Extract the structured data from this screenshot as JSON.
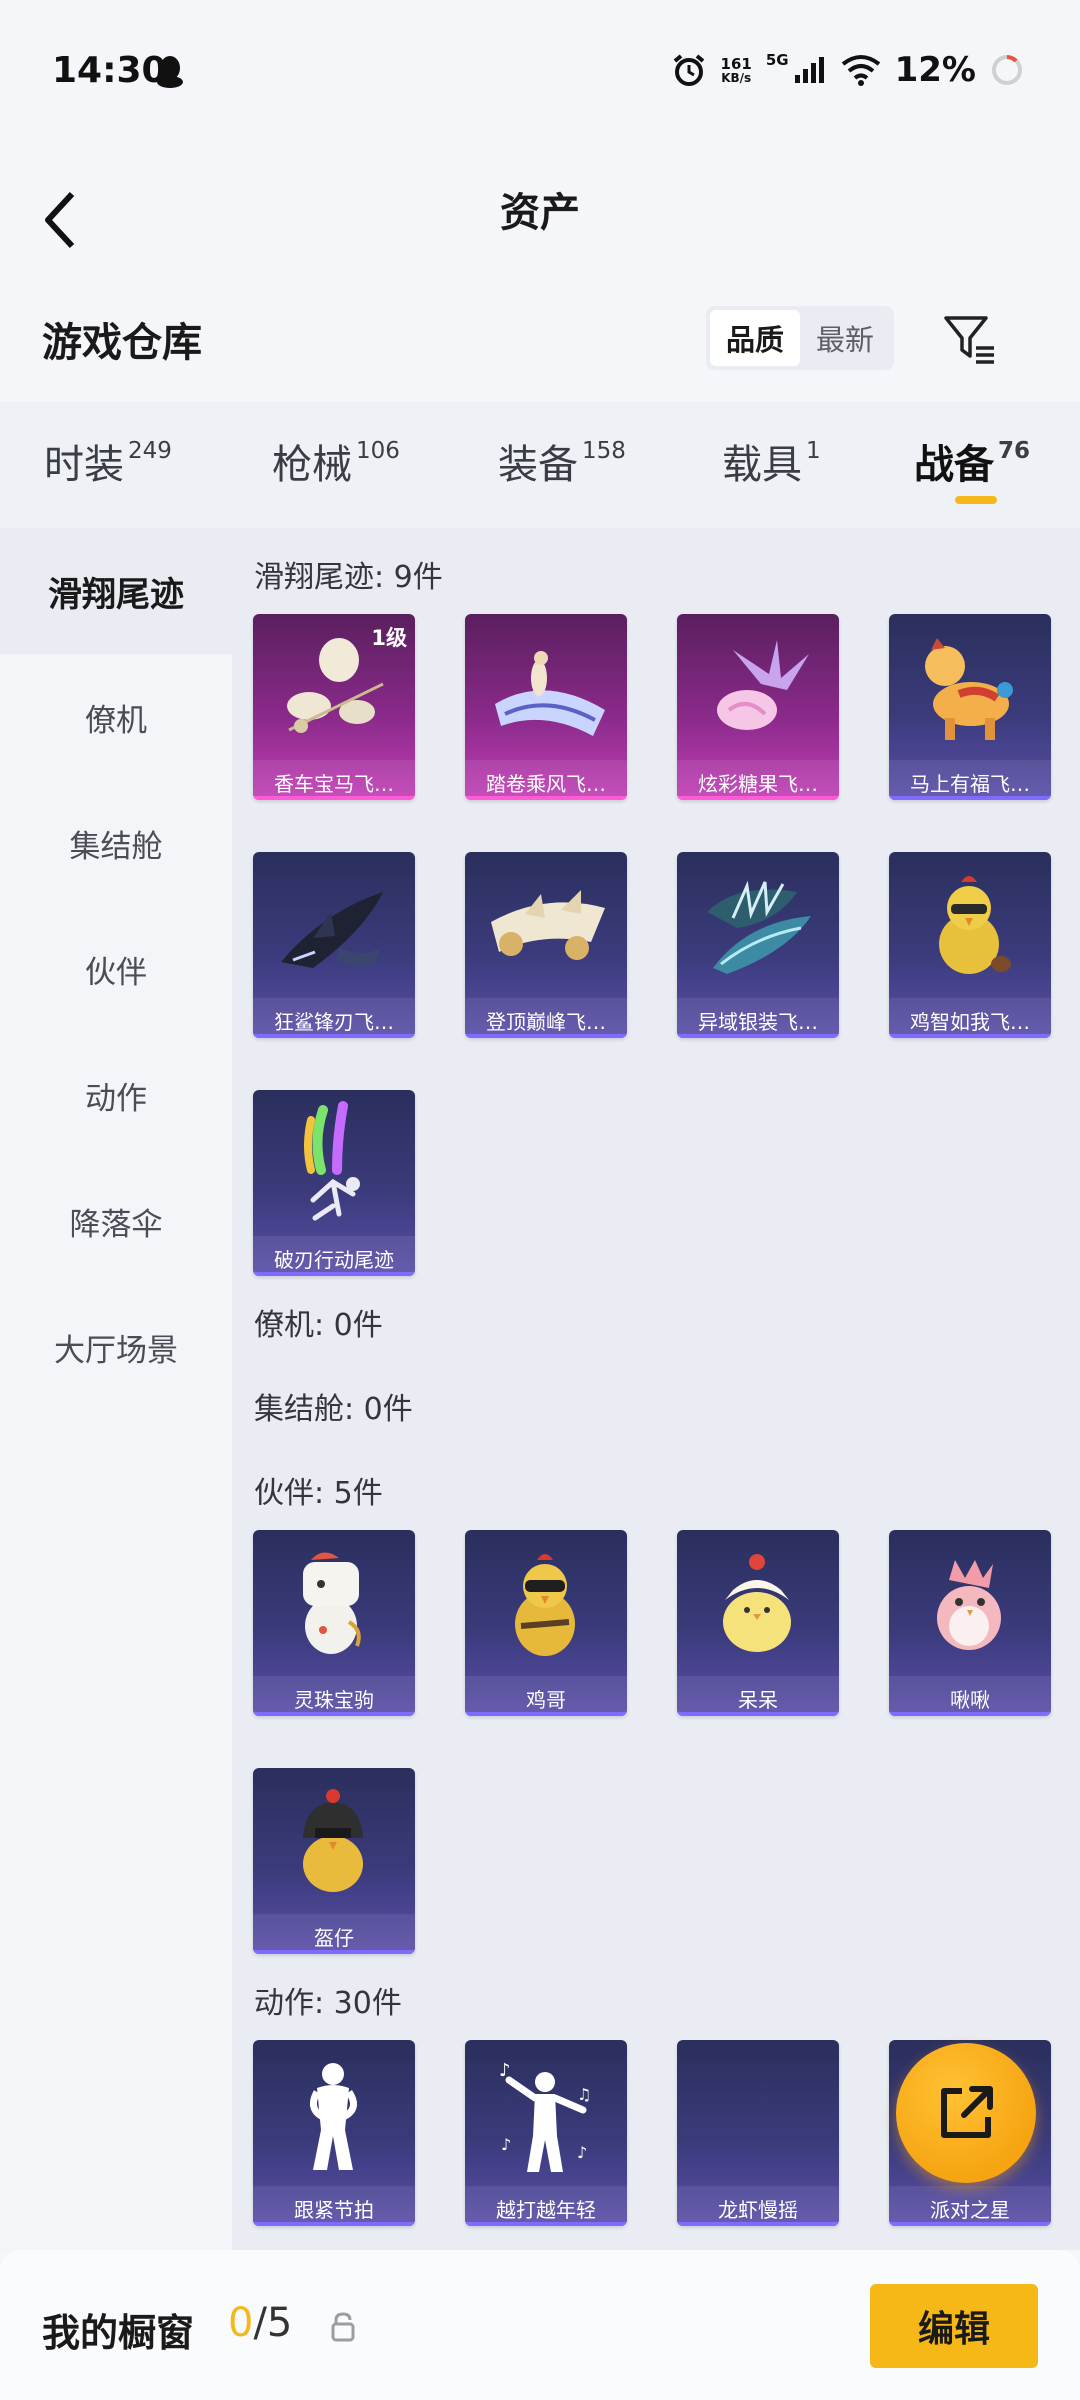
{
  "status_bar": {
    "time": "14:30",
    "net_speed": "161",
    "net_unit": "KB/s",
    "network_type": "5G",
    "battery": "12%"
  },
  "header": {
    "title": "资产"
  },
  "warehouse": {
    "title": "游戏仓库",
    "sort_options": [
      "品质",
      "最新"
    ],
    "active_sort": "品质"
  },
  "tabs": [
    {
      "label": "时装",
      "count": "249"
    },
    {
      "label": "枪械",
      "count": "106"
    },
    {
      "label": "装备",
      "count": "158"
    },
    {
      "label": "载具",
      "count": "1"
    },
    {
      "label": "战备",
      "count": "76"
    }
  ],
  "active_tab": "战备",
  "sidenav": [
    "滑翔尾迹",
    "僚机",
    "集结舱",
    "伙伴",
    "动作",
    "降落伞",
    "大厅场景"
  ],
  "active_nav": "滑翔尾迹",
  "sections": {
    "glide": {
      "title": "滑翔尾迹: 9件",
      "items": [
        {
          "name": "香车宝马飞…",
          "level": "1级",
          "rarity": "pink"
        },
        {
          "name": "踏卷乘风飞…",
          "rarity": "pink"
        },
        {
          "name": "炫彩糖果飞…",
          "rarity": "pink"
        },
        {
          "name": "马上有福飞…",
          "rarity": "blue"
        },
        {
          "name": "狂鲨锋刃飞…",
          "rarity": "blue"
        },
        {
          "name": "登顶巅峰飞…",
          "rarity": "blue"
        },
        {
          "name": "异域银装飞…",
          "rarity": "blue"
        },
        {
          "name": "鸡智如我飞…",
          "rarity": "blue"
        },
        {
          "name": "破刃行动尾迹",
          "rarity": "blue"
        }
      ]
    },
    "wingman": {
      "title": "僚机: 0件"
    },
    "pod": {
      "title": "集结舱: 0件"
    },
    "partner": {
      "title": "伙伴: 5件",
      "items": [
        {
          "name": "灵珠宝驹"
        },
        {
          "name": "鸡哥"
        },
        {
          "name": "呆呆"
        },
        {
          "name": "啾啾"
        },
        {
          "name": "盔仔"
        }
      ]
    },
    "emote": {
      "title": "动作: 30件",
      "items": [
        {
          "name": "跟紧节拍"
        },
        {
          "name": "越打越年轻"
        },
        {
          "name": "龙虾慢摇"
        },
        {
          "name": "派对之星"
        }
      ]
    }
  },
  "bottom": {
    "title": "我的橱窗",
    "current": "0",
    "total": "/5",
    "edit_label": "编辑"
  },
  "colors": {
    "accent": "#f4b81c",
    "pink_card": "#c23fb6",
    "blue_card": "#3b3b7c"
  }
}
